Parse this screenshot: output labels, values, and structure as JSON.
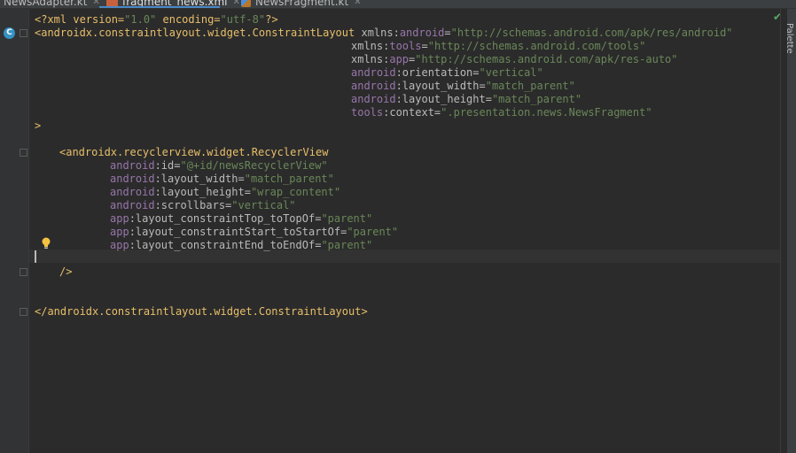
{
  "tabs": [
    {
      "label": "NewsAdapter.kt",
      "active": false
    },
    {
      "label": "fragment_news.xml",
      "active": true
    },
    {
      "label": "NewsFragment.kt",
      "active": false
    }
  ],
  "sidebar": {
    "palette_label": "Palette"
  },
  "status": {
    "inspection_ok": "✔"
  },
  "code": {
    "l1": {
      "p1": "<?xml version=",
      "v1": "\"1.0\"",
      "p2": " encoding=",
      "v2": "\"utf-8\"",
      "p3": "?>"
    },
    "l2": {
      "tag": "<androidx.constraintlayout.widget.ConstraintLayout",
      "ns": "xmlns:",
      "attr": "android",
      "eq": "=",
      "val": "\"http://schemas.android.com/apk/res/android\""
    },
    "l3": {
      "ns": "xmlns:",
      "attr": "tools",
      "eq": "=",
      "val": "\"http://schemas.android.com/tools\""
    },
    "l4": {
      "ns": "xmlns:",
      "attr": "app",
      "eq": "=",
      "val": "\"http://schemas.android.com/apk/res-auto\""
    },
    "l5": {
      "ns": "android",
      "attr": ":orientation=",
      "val": "\"vertical\""
    },
    "l6": {
      "ns": "android",
      "attr": ":layout_width=",
      "val": "\"match_parent\""
    },
    "l7": {
      "ns": "android",
      "attr": ":layout_height=",
      "val": "\"match_parent\""
    },
    "l8": {
      "ns": "tools",
      "attr": ":context=",
      "val": "\".presentation.news.NewsFragment\""
    },
    "l9": {
      "tag": ">"
    },
    "l10": {
      "tag": "<androidx.recyclerview.widget.RecyclerView"
    },
    "l11": {
      "ns": "android",
      "attr": ":id=",
      "val": "\"@+id/newsRecyclerView\""
    },
    "l12": {
      "ns": "android",
      "attr": ":layout_width=",
      "val": "\"match_parent\""
    },
    "l13": {
      "ns": "android",
      "attr": ":layout_height=",
      "val": "\"wrap_content\""
    },
    "l14": {
      "ns": "android",
      "attr": ":scrollbars=",
      "val": "\"vertical\""
    },
    "l15": {
      "ns": "app",
      "attr": ":layout_constraintTop_toTopOf=",
      "val": "\"parent\""
    },
    "l16": {
      "ns": "app",
      "attr": ":layout_constraintStart_toStartOf=",
      "val": "\"parent\""
    },
    "l17": {
      "ns": "app",
      "attr": ":layout_constraintEnd_toEndOf=",
      "val": "\"parent\""
    },
    "l18": {
      "tag": "/>"
    },
    "l19": {
      "tag": "</androidx.constraintlayout.widget.ConstraintLayout>"
    }
  }
}
